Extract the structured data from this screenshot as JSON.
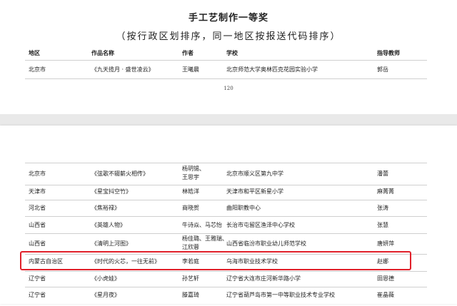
{
  "title": "手工艺制作一等奖",
  "subtitle": "（按行政区划排序，同一地区按报送代码排序）",
  "headers": {
    "region": "地区",
    "work": "作品名称",
    "author": "作者",
    "school": "学校",
    "teacher": "指导教师"
  },
  "page1_rows": [
    {
      "region": "北京市",
      "work": "《九天揽月 · 盛世凌云》",
      "author": [
        "王曦晨"
      ],
      "school": "北京师范大学奥林匹克花园实验小学",
      "teacher": "郭岳"
    }
  ],
  "page_number": "120",
  "page2_rows": [
    {
      "region": "北京市",
      "work": "《弦歌不辍薪火相传》",
      "author": [
        "杨玥锡、",
        "王思宇"
      ],
      "school": "北京市顺义区第九中学",
      "teacher": "潘蕾"
    },
    {
      "region": "天津市",
      "work": "《星宝抖空竹》",
      "author": [
        "林皓洋"
      ],
      "school": "天津市和平区新星小学",
      "teacher": "麻菁菁"
    },
    {
      "region": "河北省",
      "work": "《焦裕禄》",
      "author": [
        "商晓贺"
      ],
      "school": "曲阳职教中心",
      "teacher": "张涛"
    },
    {
      "region": "山西省",
      "work": "《英雄人物》",
      "author": [
        "牛诗焱、马芯怡"
      ],
      "school": "长治市屯留区渔泽中心学校",
      "teacher": "张慧"
    },
    {
      "region": "山西省",
      "work": "《清明上河图》",
      "author": [
        "杨佳璐、王雅瑞、",
        "江欣蓉"
      ],
      "school": "山西省临汾市职业幼儿师范学校",
      "teacher": "唐妍萍"
    },
    {
      "region": "内蒙古自治区",
      "work": "《时代的火芯，一往无前》",
      "author": [
        "李若庭"
      ],
      "school": "乌海市职业技术学校",
      "teacher": "赵娜"
    },
    {
      "region": "辽宁省",
      "work": "《小虎娃》",
      "author": [
        "孙艺轩"
      ],
      "school": "辽宁省大连市庄河新华路小学",
      "teacher": "田恩德"
    },
    {
      "region": "辽宁省",
      "work": "《星月夜》",
      "author": [
        "滕嘉琦"
      ],
      "school": "辽宁省葫芦岛市第一中等职业技术专业学校",
      "teacher": "崔晶薇"
    }
  ],
  "highlight_color": "#e0202a"
}
